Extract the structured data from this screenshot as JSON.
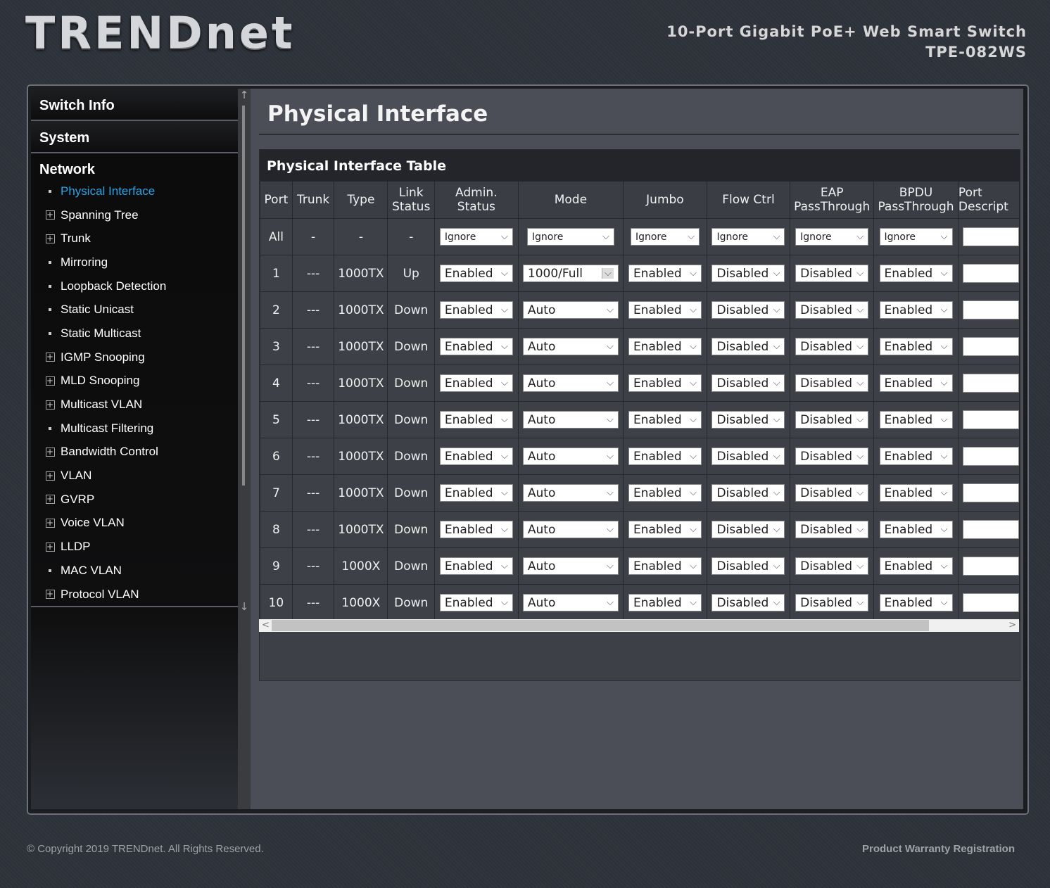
{
  "brand": {
    "logo": "TRENDnet",
    "product_line1": "10-Port Gigabit PoE+ Web Smart Switch",
    "product_line2": "TPE-082WS"
  },
  "sidebar": {
    "sections": [
      "Switch Info",
      "System"
    ],
    "group_title": "Network",
    "items": [
      {
        "label": "Physical Interface",
        "marker": "bullet",
        "active": true
      },
      {
        "label": "Spanning Tree",
        "marker": "plus"
      },
      {
        "label": "Trunk",
        "marker": "plus"
      },
      {
        "label": "Mirroring",
        "marker": "bullet"
      },
      {
        "label": "Loopback Detection",
        "marker": "bullet"
      },
      {
        "label": "Static Unicast",
        "marker": "bullet"
      },
      {
        "label": "Static Multicast",
        "marker": "bullet"
      },
      {
        "label": "IGMP Snooping",
        "marker": "plus"
      },
      {
        "label": "MLD Snooping",
        "marker": "plus"
      },
      {
        "label": "Multicast VLAN",
        "marker": "plus"
      },
      {
        "label": "Multicast Filtering",
        "marker": "bullet"
      },
      {
        "label": "Bandwidth Control",
        "marker": "plus"
      },
      {
        "label": "VLAN",
        "marker": "plus"
      },
      {
        "label": "GVRP",
        "marker": "plus"
      },
      {
        "label": "Voice VLAN",
        "marker": "plus"
      },
      {
        "label": "LLDP",
        "marker": "plus"
      },
      {
        "label": "MAC VLAN",
        "marker": "bullet"
      },
      {
        "label": "Protocol VLAN",
        "marker": "plus"
      }
    ]
  },
  "main": {
    "page_title": "Physical Interface",
    "table_title": "Physical Interface Table",
    "headers": [
      "Port",
      "Trunk",
      "Type",
      "Link\nStatus",
      "Admin.\nStatus",
      "Mode",
      "Jumbo",
      "Flow Ctrl",
      "EAP\nPassThrough",
      "BPDU\nPassThrough",
      "Port\nDescript"
    ],
    "all_row": {
      "port": "All",
      "trunk": "-",
      "type": "-",
      "link": "-",
      "admin": "Ignore",
      "mode": "Ignore",
      "jumbo": "Ignore",
      "flow": "Ignore",
      "eap": "Ignore",
      "bpdu": "Ignore"
    },
    "rows": [
      {
        "port": "1",
        "trunk": "---",
        "type": "1000TX",
        "link": "Up",
        "admin": "Enabled",
        "mode": "1000/Full",
        "jumbo": "Enabled",
        "flow": "Disabled",
        "eap": "Disabled",
        "bpdu": "Enabled"
      },
      {
        "port": "2",
        "trunk": "---",
        "type": "1000TX",
        "link": "Down",
        "admin": "Enabled",
        "mode": "Auto",
        "jumbo": "Enabled",
        "flow": "Disabled",
        "eap": "Disabled",
        "bpdu": "Enabled"
      },
      {
        "port": "3",
        "trunk": "---",
        "type": "1000TX",
        "link": "Down",
        "admin": "Enabled",
        "mode": "Auto",
        "jumbo": "Enabled",
        "flow": "Disabled",
        "eap": "Disabled",
        "bpdu": "Enabled"
      },
      {
        "port": "4",
        "trunk": "---",
        "type": "1000TX",
        "link": "Down",
        "admin": "Enabled",
        "mode": "Auto",
        "jumbo": "Enabled",
        "flow": "Disabled",
        "eap": "Disabled",
        "bpdu": "Enabled"
      },
      {
        "port": "5",
        "trunk": "---",
        "type": "1000TX",
        "link": "Down",
        "admin": "Enabled",
        "mode": "Auto",
        "jumbo": "Enabled",
        "flow": "Disabled",
        "eap": "Disabled",
        "bpdu": "Enabled"
      },
      {
        "port": "6",
        "trunk": "---",
        "type": "1000TX",
        "link": "Down",
        "admin": "Enabled",
        "mode": "Auto",
        "jumbo": "Enabled",
        "flow": "Disabled",
        "eap": "Disabled",
        "bpdu": "Enabled"
      },
      {
        "port": "7",
        "trunk": "---",
        "type": "1000TX",
        "link": "Down",
        "admin": "Enabled",
        "mode": "Auto",
        "jumbo": "Enabled",
        "flow": "Disabled",
        "eap": "Disabled",
        "bpdu": "Enabled"
      },
      {
        "port": "8",
        "trunk": "---",
        "type": "1000TX",
        "link": "Down",
        "admin": "Enabled",
        "mode": "Auto",
        "jumbo": "Enabled",
        "flow": "Disabled",
        "eap": "Disabled",
        "bpdu": "Enabled"
      },
      {
        "port": "9",
        "trunk": "---",
        "type": "1000X",
        "link": "Down",
        "admin": "Enabled",
        "mode": "Auto",
        "jumbo": "Enabled",
        "flow": "Disabled",
        "eap": "Disabled",
        "bpdu": "Enabled"
      },
      {
        "port": "10",
        "trunk": "---",
        "type": "1000X",
        "link": "Down",
        "admin": "Enabled",
        "mode": "Auto",
        "jumbo": "Enabled",
        "flow": "Disabled",
        "eap": "Disabled",
        "bpdu": "Enabled"
      }
    ]
  },
  "footer": {
    "copyright": "© Copyright 2019 TRENDnet. All Rights Reserved.",
    "link": "Product Warranty Registration"
  },
  "colors": {
    "active_nav": "#2aa5e8",
    "content_bg": "#4b4e56"
  }
}
